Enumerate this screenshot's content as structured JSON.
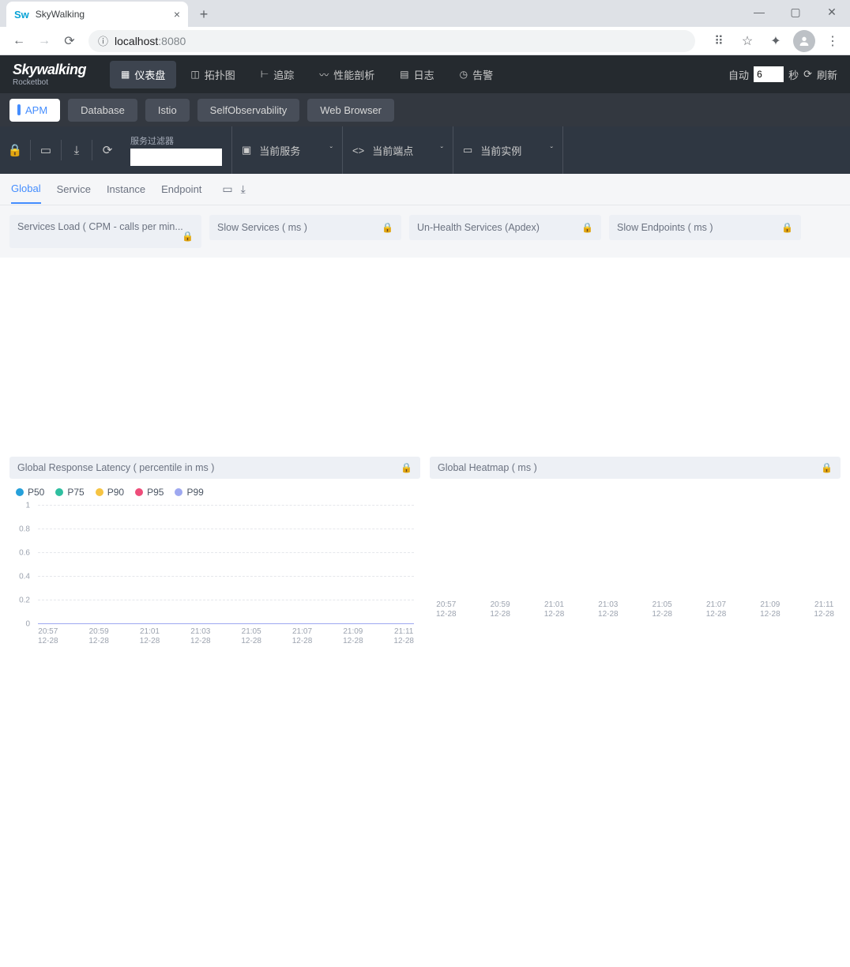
{
  "browser": {
    "tab_title": "SkyWalking",
    "url_host": "localhost",
    "url_port": ":8080"
  },
  "topnav": {
    "logo_main": "Skywalking",
    "logo_sub": "Rocketbot",
    "items": [
      {
        "label": "仪表盘"
      },
      {
        "label": "拓扑图"
      },
      {
        "label": "追踪"
      },
      {
        "label": "性能剖析"
      },
      {
        "label": "日志"
      },
      {
        "label": "告警"
      }
    ],
    "auto_label": "自动",
    "auto_value": "6",
    "seconds_label": "秒",
    "refresh_label": "刷新"
  },
  "subnav": {
    "pills": [
      {
        "label": "APM",
        "active": true
      },
      {
        "label": "Database"
      },
      {
        "label": "Istio"
      },
      {
        "label": "SelfObservability"
      },
      {
        "label": "Web Browser"
      }
    ]
  },
  "toolbar": {
    "filter_label": "服务过滤器",
    "filter_value": "",
    "selectors": [
      {
        "label": "当前服务"
      },
      {
        "label": "当前端点"
      },
      {
        "label": "当前实例"
      }
    ]
  },
  "tabs2": {
    "items": [
      {
        "label": "Global",
        "active": true
      },
      {
        "label": "Service"
      },
      {
        "label": "Instance"
      },
      {
        "label": "Endpoint"
      }
    ]
  },
  "cards_top": [
    {
      "title": "Services Load ( CPM - calls per min..."
    },
    {
      "title": "Slow Services ( ms )"
    },
    {
      "title": "Un-Health Services (Apdex)"
    },
    {
      "title": "Slow Endpoints ( ms )"
    }
  ],
  "latency_card": {
    "title": "Global Response Latency ( percentile in ms )",
    "legend": [
      {
        "name": "P50",
        "color": "#26a0da"
      },
      {
        "name": "P75",
        "color": "#2fbfa0"
      },
      {
        "name": "P90",
        "color": "#f6c443"
      },
      {
        "name": "P95",
        "color": "#ee4d7a"
      },
      {
        "name": "P99",
        "color": "#9ea8f0"
      }
    ]
  },
  "heatmap_card": {
    "title": "Global Heatmap ( ms )"
  },
  "chart_data": [
    {
      "type": "line",
      "title": "Global Response Latency ( percentile in ms )",
      "xlabel": "",
      "ylabel": "",
      "ylim": [
        0,
        1
      ],
      "y_ticks": [
        0,
        0.2,
        0.4,
        0.6,
        0.8,
        1
      ],
      "x_ticks": [
        {
          "time": "20:57",
          "date": "12-28"
        },
        {
          "time": "20:59",
          "date": "12-28"
        },
        {
          "time": "21:01",
          "date": "12-28"
        },
        {
          "time": "21:03",
          "date": "12-28"
        },
        {
          "time": "21:05",
          "date": "12-28"
        },
        {
          "time": "21:07",
          "date": "12-28"
        },
        {
          "time": "21:09",
          "date": "12-28"
        },
        {
          "time": "21:11",
          "date": "12-28"
        }
      ],
      "series": [
        {
          "name": "P50",
          "values": [
            0,
            0,
            0,
            0,
            0,
            0,
            0,
            0
          ]
        },
        {
          "name": "P75",
          "values": [
            0,
            0,
            0,
            0,
            0,
            0,
            0,
            0
          ]
        },
        {
          "name": "P90",
          "values": [
            0,
            0,
            0,
            0,
            0,
            0,
            0,
            0
          ]
        },
        {
          "name": "P95",
          "values": [
            0,
            0,
            0,
            0,
            0,
            0,
            0,
            0
          ]
        },
        {
          "name": "P99",
          "values": [
            0,
            0,
            0,
            0,
            0,
            0,
            0,
            0
          ]
        }
      ]
    },
    {
      "type": "heatmap",
      "title": "Global Heatmap ( ms )",
      "x_ticks": [
        {
          "time": "20:57",
          "date": "12-28"
        },
        {
          "time": "20:59",
          "date": "12-28"
        },
        {
          "time": "21:01",
          "date": "12-28"
        },
        {
          "time": "21:03",
          "date": "12-28"
        },
        {
          "time": "21:05",
          "date": "12-28"
        },
        {
          "time": "21:07",
          "date": "12-28"
        },
        {
          "time": "21:09",
          "date": "12-28"
        },
        {
          "time": "21:11",
          "date": "12-28"
        }
      ],
      "data": []
    }
  ]
}
